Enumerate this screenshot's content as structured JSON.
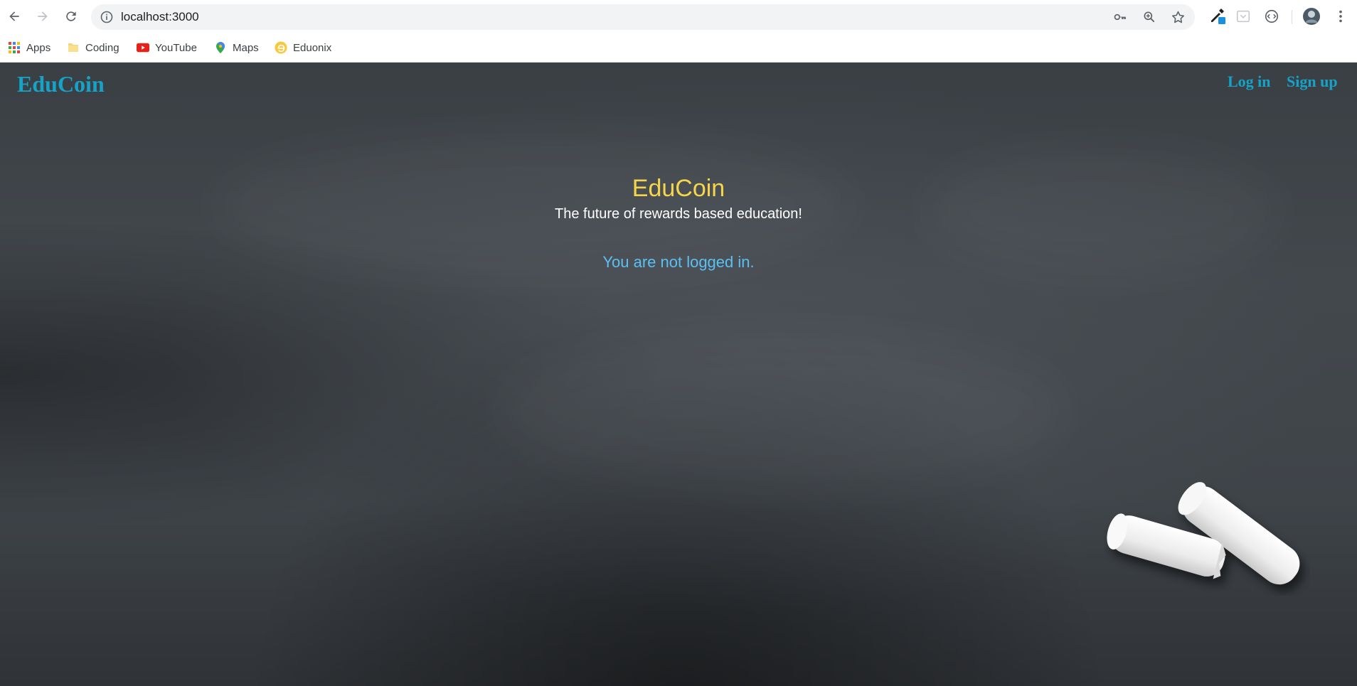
{
  "browser": {
    "url": "localhost:3000",
    "bookmarks": [
      {
        "label": "Apps",
        "icon": "apps-grid-icon"
      },
      {
        "label": "Coding",
        "icon": "folder-icon"
      },
      {
        "label": "YouTube",
        "icon": "youtube-icon"
      },
      {
        "label": "Maps",
        "icon": "maps-pin-icon"
      },
      {
        "label": "Eduonix",
        "icon": "eduonix-icon"
      }
    ]
  },
  "navbar": {
    "brand": "EduCoin",
    "login": "Log in",
    "signup": "Sign up",
    "link_color": "#17a2c8"
  },
  "hero": {
    "title": "EduCoin",
    "subtitle": "The future of rewards based education!",
    "status": "You are not logged in.",
    "title_color": "#f5d64a",
    "status_color": "#5bc0f2"
  }
}
